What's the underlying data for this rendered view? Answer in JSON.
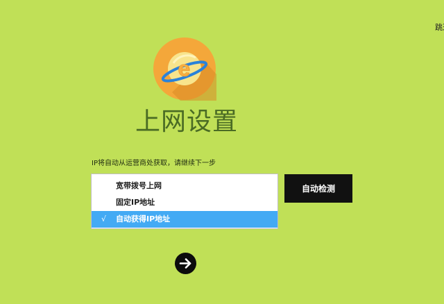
{
  "header": {
    "skip_label": "跳过"
  },
  "logo": {
    "icon": "ie-planet-icon",
    "circle_color": "#f4a73a",
    "letter": "e",
    "letter_color": "#1e78c2",
    "ring_color": "#2b82d9"
  },
  "page": {
    "title": "上网设置",
    "hint": "IP将自动从运营商处获取，请继续下一步"
  },
  "connection_type": {
    "options": [
      {
        "label": "宽带拨号上网"
      },
      {
        "label": "固定IP地址"
      },
      {
        "label": "自动获得IP地址",
        "check": "√"
      }
    ],
    "selected_color": "#43aaf4"
  },
  "actions": {
    "detect_label": "自动检测",
    "next_icon": "arrow-right-icon"
  }
}
